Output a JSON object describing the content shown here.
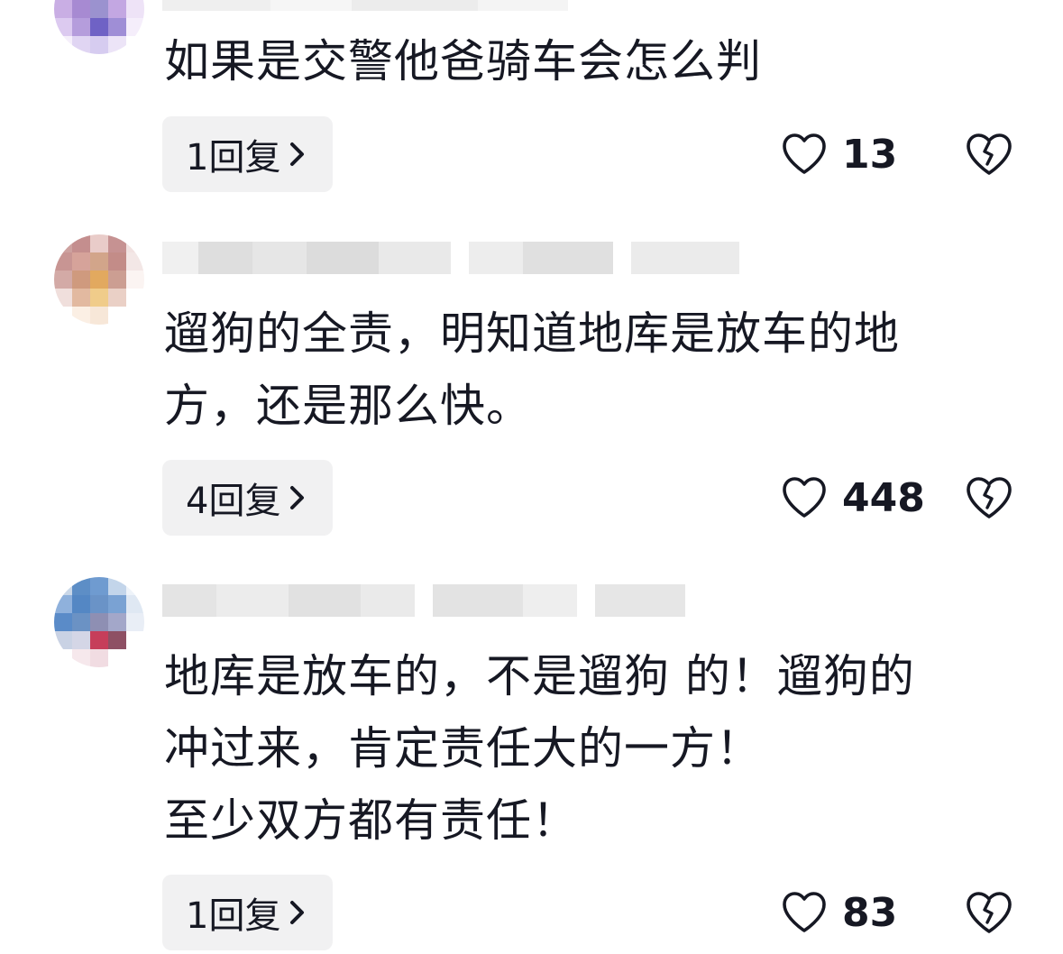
{
  "comments": [
    {
      "username": "",
      "text": "如果是交警他爸骑车会怎么判",
      "reply_label": "1回复",
      "like_count": "13"
    },
    {
      "username": "",
      "text": "遛狗的全责，明知道地库是放车的地\n方，还是那么快。",
      "reply_label": "4回复",
      "like_count": "448"
    },
    {
      "username": "",
      "text": "地库是放车的，不是遛狗 的！遛狗的\n冲过来，肯定责任大的一方！\n至少双方都有责任！",
      "reply_label": "1回复",
      "like_count": "83"
    }
  ],
  "icons": {
    "like": "heart-outline-icon",
    "dislike": "broken-heart-icon",
    "reply_arrow": "chevron-right-icon"
  },
  "colors": {
    "text": "#161823",
    "reply_button_bg": "#f1f1f2",
    "background": "#ffffff"
  }
}
